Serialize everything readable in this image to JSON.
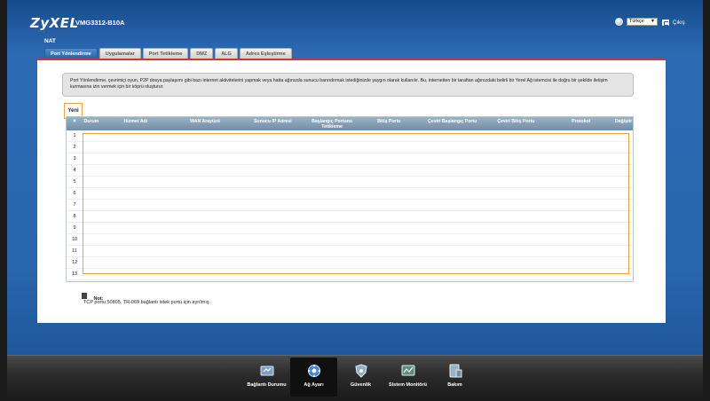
{
  "brand": {
    "logo": "ZyXEL",
    "model": "VMG3312-B10A"
  },
  "header": {
    "language": "Türkçe",
    "logout": "Çıkış"
  },
  "section_title": "NAT",
  "tabs": [
    {
      "label": "Port Yönlendirme",
      "active": true
    },
    {
      "label": "Uygulamalar",
      "active": false
    },
    {
      "label": "Port Tetikleme",
      "active": false
    },
    {
      "label": "DMZ",
      "active": false
    },
    {
      "label": "ALG",
      "active": false
    },
    {
      "label": "Adres Eşleştirme",
      "active": false
    }
  ],
  "description": "Port Yönlendirme, çevrimiçi oyun, P2P dosya paylaşımı gibi bazı internet aktivitelerini yapmak veya hatta ağınızda sunucu barındırmak istediğinizde yaygın olarak kullanılır. Bu, internetten bir taraftan ağınızdaki belirli bir Yerel Ağ istemcisi ile doğru bir şekilde iletişim kurmasına izin vermek için bir köprü oluşturur.",
  "new_button": "Yeni",
  "table": {
    "columns": [
      "#",
      "Durum",
      "Hizmet Adı",
      "WAN Arayüzü",
      "Sunucu IP Adresi",
      "Başlangıç Portunu Tetikleme",
      "Bitiş Portu",
      "Çeviri Başlangıç Portu",
      "Çeviri Bitiş Portu",
      "Protokol",
      "Değiştir"
    ],
    "rows": [
      "1",
      "2",
      "3",
      "4",
      "5",
      "6",
      "7",
      "8",
      "9",
      "10",
      "11",
      "12",
      "13"
    ]
  },
  "note": {
    "title": "Not:",
    "text": "TCP portu 50805, TR-069 bağlantı istek portu için ayrılmış"
  },
  "dock": [
    {
      "label": "Bağlantı Durumu",
      "icon": "connection-status-icon",
      "active": false
    },
    {
      "label": "Ağ Ayarı",
      "icon": "network-setting-icon",
      "active": true
    },
    {
      "label": "Güvenlik",
      "icon": "security-icon",
      "active": false
    },
    {
      "label": "Sistem Monitörü",
      "icon": "system-monitor-icon",
      "active": false
    },
    {
      "label": "Bakım",
      "icon": "maintenance-icon",
      "active": false
    }
  ]
}
